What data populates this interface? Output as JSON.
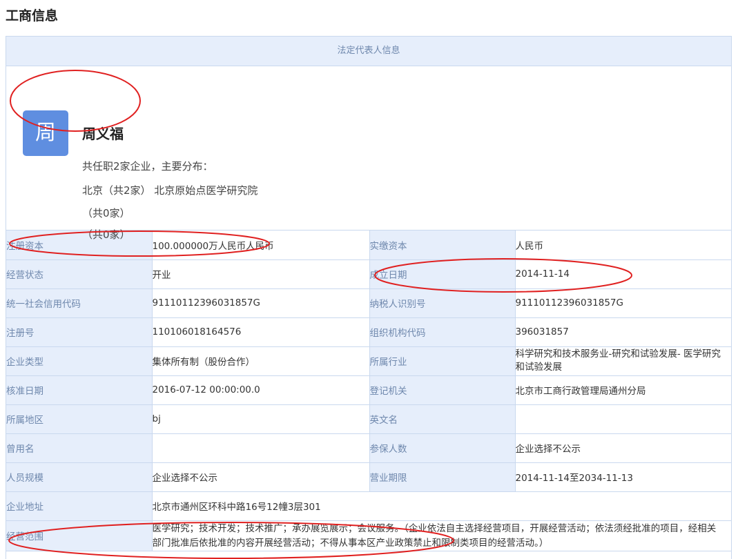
{
  "page_title": "工商信息",
  "legal_rep": {
    "header": "法定代表人信息",
    "avatar_char": "周",
    "name": "周义福",
    "summary": "共任职2家企业，主要分布：",
    "line_region": "北京（共2家） 北京原始点医学研究院",
    "line_a": "（共0家）",
    "line_b": "（共0家）"
  },
  "rows": [
    {
      "l1": "注册资本",
      "v1": "100.000000万人民币人民币",
      "l2": "实缴资本",
      "v2": "人民币"
    },
    {
      "l1": "经营状态",
      "v1": "开业",
      "l2": "成立日期",
      "v2": "2014-11-14"
    },
    {
      "l1": "统一社会信用代码",
      "v1": "91110112396031857G",
      "l2": "纳税人识别号",
      "v2": "91110112396031857G"
    },
    {
      "l1": "注册号",
      "v1": "110106018164576",
      "l2": "组织机构代码",
      "v2": "396031857"
    },
    {
      "l1": "企业类型",
      "v1": "集体所有制（股份合作）",
      "l2": "所属行业",
      "v2": "科学研究和技术服务业-研究和试验发展- 医学研究和试验发展"
    },
    {
      "l1": "核准日期",
      "v1": "2016-07-12 00:00:00.0",
      "l2": "登记机关",
      "v2": "北京市工商行政管理局通州分局"
    },
    {
      "l1": "所属地区",
      "v1": "bj",
      "l2": "英文名",
      "v2": ""
    },
    {
      "l1": "曾用名",
      "v1": "",
      "l2": "参保人数",
      "v2": "企业选择不公示"
    },
    {
      "l1": "人员规模",
      "v1": "企业选择不公示",
      "l2": "营业期限",
      "v2": "2014-11-14至2034-11-13"
    }
  ],
  "address": {
    "label": "企业地址",
    "value": "北京市通州区环科中路16号12幢3层301"
  },
  "scope": {
    "label": "经营范围",
    "value": "医学研究；技术开发；技术推广；承办展览展示；会议服务。（企业依法自主选择经营项目，开展经营活动；依法须经批准的项目，经相关部门批准后依批准的内容开展经营活动；不得从事本区产业政策禁止和限制类项目的经营活动。）"
  },
  "annotation_color": "#e02020"
}
